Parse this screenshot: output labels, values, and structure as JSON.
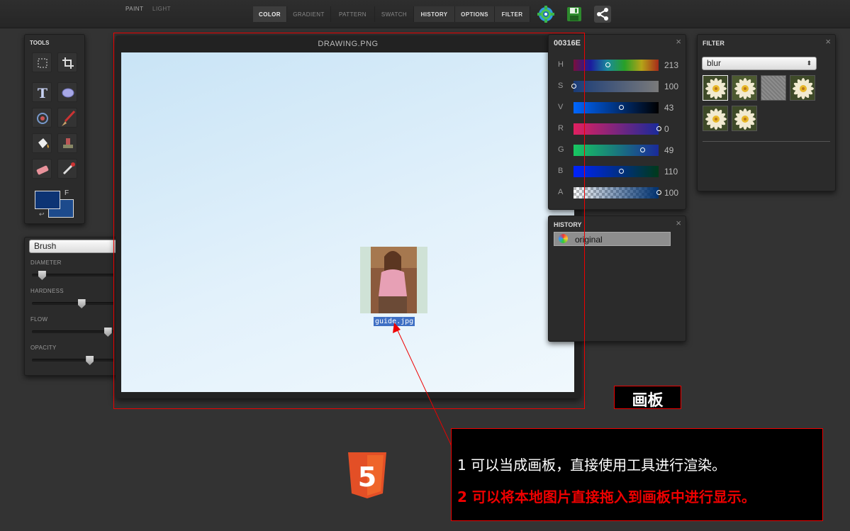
{
  "topbar": {
    "modes": [
      "PAINT",
      "LIGHT"
    ],
    "tabs": [
      "COLOR",
      "GRADIENT",
      "PATTERN",
      "SWATCH",
      "HISTORY",
      "OPTIONS",
      "FILTER"
    ],
    "icons": [
      "gear-icon",
      "save-icon",
      "share-icon"
    ]
  },
  "tools": {
    "title": "TOOLS",
    "items": [
      "rect-select-icon",
      "crop-icon",
      "text-icon",
      "ellipse-icon",
      "stamp-pattern-icon",
      "brush-icon",
      "fill-bucket-icon",
      "clone-stamp-icon",
      "eraser-icon",
      "eyedropper-icon"
    ],
    "fg_color": "#0d3474",
    "bg_color": "#1c4a8c",
    "swap_label": "F"
  },
  "brush": {
    "selected": "Brush",
    "sliders": [
      {
        "label": "DIAMETER",
        "value": "10",
        "fraction": 0.12
      },
      {
        "label": "HARDNESS",
        "value": "60",
        "fraction": 0.6
      },
      {
        "label": "FLOW",
        "value": "92",
        "fraction": 0.92
      },
      {
        "label": "OPACITY",
        "value": "70",
        "fraction": 0.7
      }
    ]
  },
  "canvas": {
    "title": "DRAWING.PNG",
    "image_caption": "guide.jpg"
  },
  "color_panel": {
    "hex": "00316E",
    "channels": [
      {
        "label": "H",
        "value": "213",
        "fraction": 0.4
      },
      {
        "label": "S",
        "value": "100",
        "fraction": 0.0
      },
      {
        "label": "V",
        "value": "43",
        "fraction": 0.56
      },
      {
        "label": "R",
        "value": "0",
        "fraction": 1.0
      },
      {
        "label": "G",
        "value": "49",
        "fraction": 0.81
      },
      {
        "label": "B",
        "value": "110",
        "fraction": 0.56
      },
      {
        "label": "A",
        "value": "100",
        "fraction": 1.0
      }
    ]
  },
  "history": {
    "title": "HISTORY",
    "items": [
      "original"
    ]
  },
  "filter": {
    "title": "FILTER",
    "selected": "blur"
  },
  "annotations": {
    "canvas_label": "画板",
    "line1": "1 可以当成画板，直接使用工具进行渲染。",
    "line2": "2 可以将本地图片直接拖入到画板中进行显示。",
    "html5_label": "5"
  }
}
